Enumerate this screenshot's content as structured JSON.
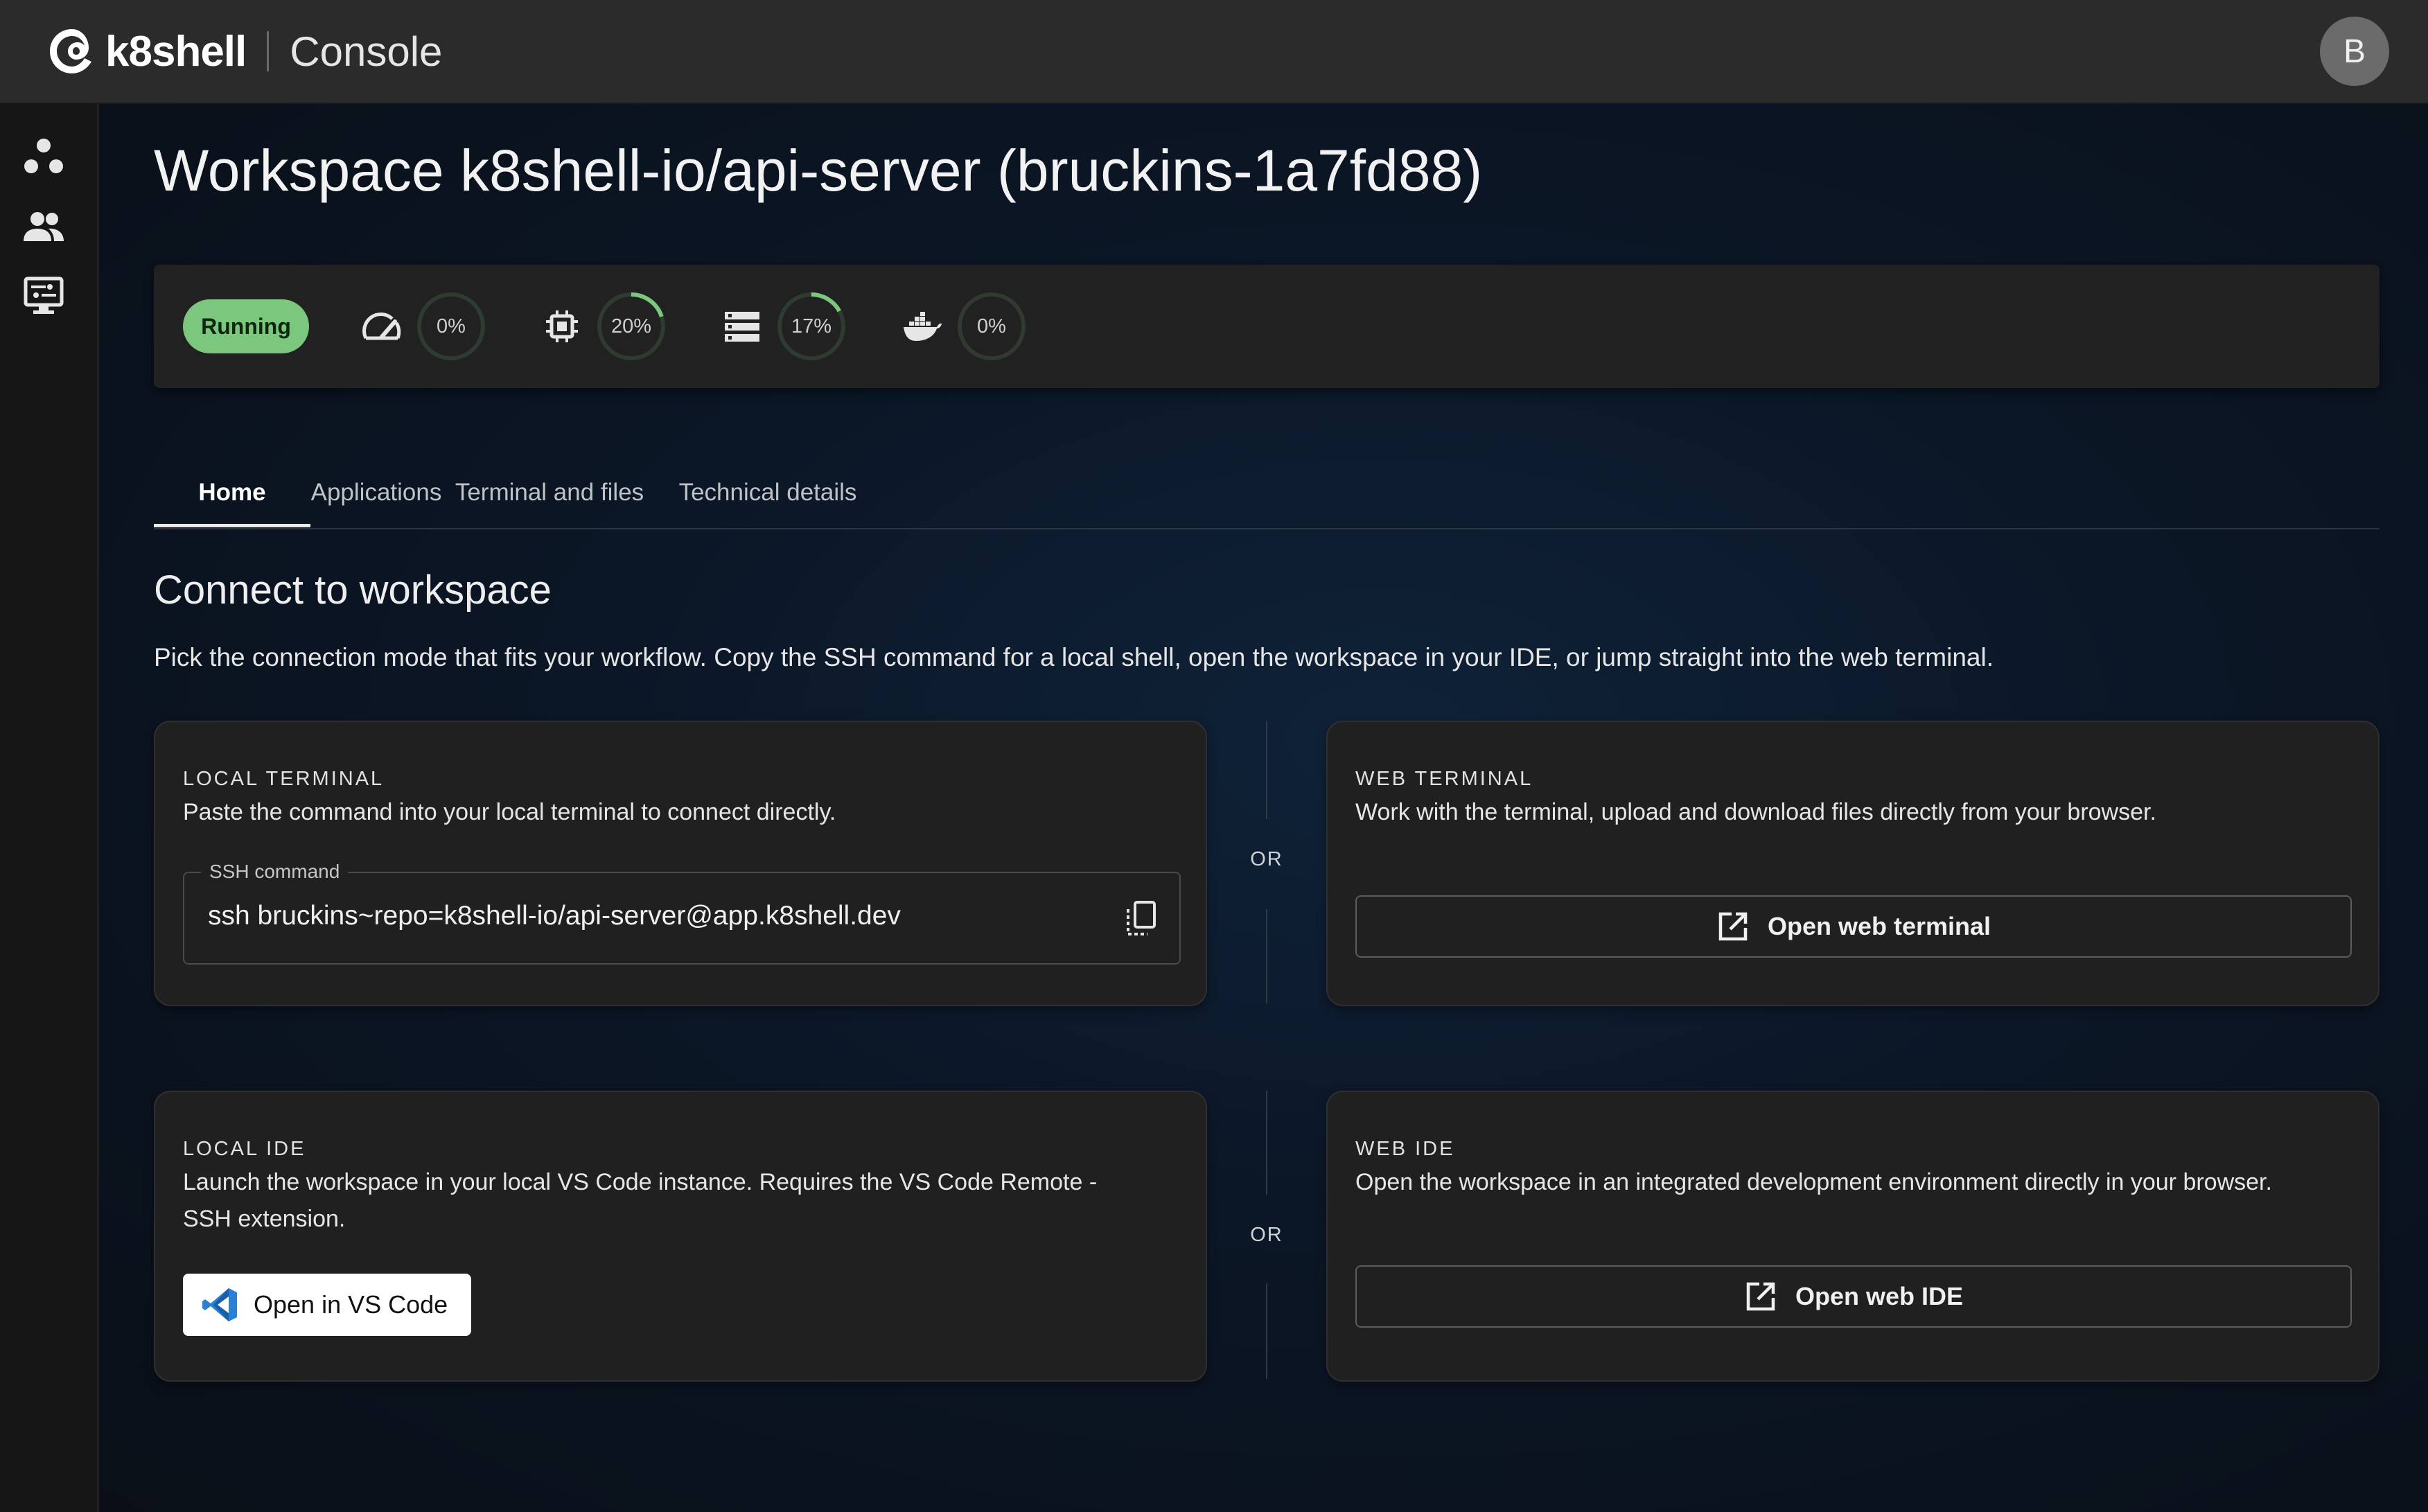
{
  "header": {
    "brand_name": "k8shell",
    "section_name": "Console",
    "avatar_initial": "B"
  },
  "sidebar": {
    "items": [
      {
        "icon": "workspaces-icon"
      },
      {
        "icon": "users-icon"
      },
      {
        "icon": "terminal-settings-icon"
      }
    ]
  },
  "page": {
    "title": "Workspace k8shell-io/api-server (bruckins-1a7fd88)"
  },
  "status": {
    "state": "Running",
    "state_color": "#7bc77e",
    "metrics": [
      {
        "icon": "speedometer-icon",
        "label": "0%",
        "value": 0
      },
      {
        "icon": "cpu-icon",
        "label": "20%",
        "value": 20
      },
      {
        "icon": "storage-icon",
        "label": "17%",
        "value": 17
      },
      {
        "icon": "docker-icon",
        "label": "0%",
        "value": 0
      }
    ]
  },
  "tabs": [
    {
      "label": "Home",
      "active": true
    },
    {
      "label": "Applications",
      "active": false
    },
    {
      "label": "Terminal and files",
      "active": false
    },
    {
      "label": "Technical details",
      "active": false
    }
  ],
  "connect": {
    "title": "Connect to workspace",
    "description": "Pick the connection mode that fits your workflow. Copy the SSH command for a local shell, open the workspace in your IDE, or jump straight into the web terminal.",
    "or_label": "OR",
    "local_terminal": {
      "label": "LOCAL TERMINAL",
      "text": "Paste the command into your local terminal to connect directly.",
      "field_label": "SSH command",
      "command": "ssh bruckins~repo=k8shell-io/api-server@app.k8shell.dev"
    },
    "web_terminal": {
      "label": "WEB TERMINAL",
      "text": "Work with the terminal, upload and download files directly from your browser.",
      "button": "Open web terminal"
    },
    "local_ide": {
      "label": "LOCAL IDE",
      "text_line1": "Launch the workspace in your local VS Code instance. Requires the VS Code Remote -",
      "text_line2": "SSH extension.",
      "button": "Open in VS Code"
    },
    "web_ide": {
      "label": "WEB IDE",
      "text": "Open the workspace in an integrated development environment directly in your browser.",
      "button": "Open web IDE"
    }
  }
}
